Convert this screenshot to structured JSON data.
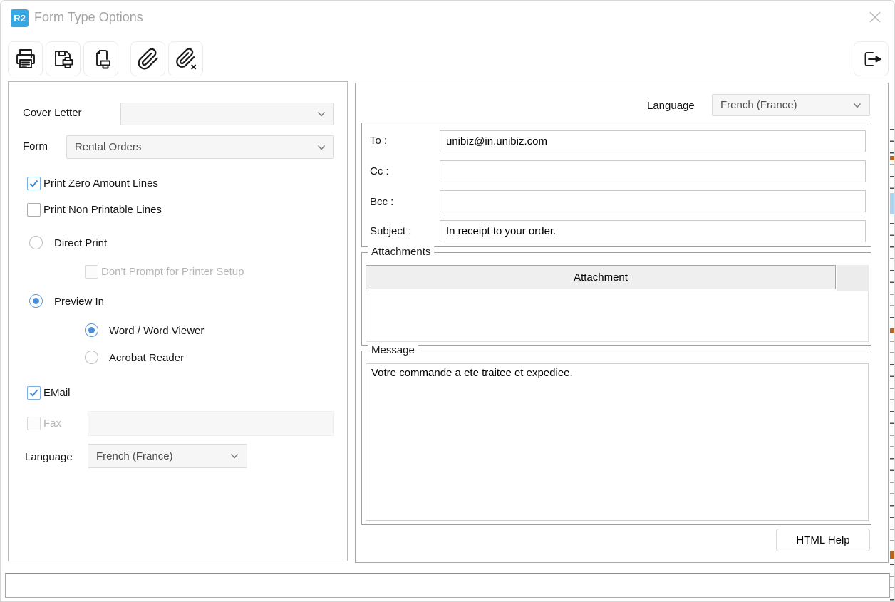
{
  "colors": {
    "accent": "#35a7e3",
    "check_blue": "#3f86d8",
    "checkbox_blue_border": "#7aafe6",
    "radio_blue": "#4a8fd8",
    "title_gray": "#a3a3a3",
    "icon_black": "#1c1c1c",
    "disabled_text": "#b4b4b4"
  },
  "window": {
    "badge_label": "R2",
    "title": "Form Type Options",
    "close_icon": "close-icon"
  },
  "toolbar": {
    "icons": [
      "print-icon",
      "save-print-icon",
      "print-setup-icon",
      "attach-icon",
      "remove-attachment-icon"
    ],
    "exit_icon": "exit-icon"
  },
  "left_panel": {
    "cover_letter": {
      "label": "Cover Letter",
      "value": ""
    },
    "form": {
      "label": "Form",
      "value": "Rental Orders"
    },
    "print_zero_amount": {
      "label": "Print Zero Amount Lines",
      "checked": true
    },
    "print_non_printable": {
      "label": "Print Non Printable Lines",
      "checked": false
    },
    "direct_print": {
      "label": "Direct Print",
      "selected": false
    },
    "dont_prompt": {
      "label": "Don't Prompt for Printer Setup",
      "checked": false,
      "disabled": true
    },
    "preview_in": {
      "label": "Preview In",
      "selected": true
    },
    "word_viewer": {
      "label": "Word / Word Viewer",
      "selected": true
    },
    "acrobat_reader": {
      "label": "Acrobat Reader",
      "selected": false
    },
    "email": {
      "label": "EMail",
      "checked": true
    },
    "fax": {
      "label": "Fax",
      "checked": false,
      "disabled": true,
      "value": ""
    },
    "language": {
      "label": "Language",
      "value": "French (France)"
    }
  },
  "right_panel": {
    "language": {
      "label": "Language",
      "value": "French (France)"
    },
    "to": {
      "label": "To :",
      "value": "unibiz@in.unibiz.com"
    },
    "cc": {
      "label": "Cc :",
      "value": ""
    },
    "bcc": {
      "label": "Bcc :",
      "value": ""
    },
    "subject": {
      "label": "Subject :",
      "value": "In receipt to your order."
    },
    "attachments": {
      "group_label": "Attachments",
      "column_header": "Attachment",
      "items": []
    },
    "message": {
      "group_label": "Message",
      "text": "Votre commande a ete traitee et expediee."
    },
    "html_help_button": "HTML Help"
  },
  "status_bar": {
    "text": ""
  }
}
